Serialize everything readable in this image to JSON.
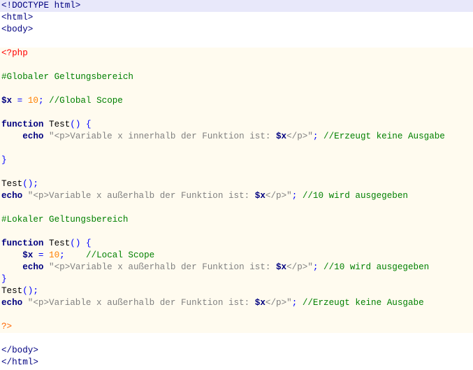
{
  "editor": {
    "lines": [
      {
        "bg": "highlight",
        "tokens": [
          {
            "t": "<!DOCTYPE html>",
            "c": "tag"
          }
        ]
      },
      {
        "bg": "",
        "tokens": [
          {
            "t": "<html>",
            "c": "tag"
          }
        ]
      },
      {
        "bg": "",
        "tokens": [
          {
            "t": "<body>",
            "c": "tag"
          }
        ]
      },
      {
        "bg": "",
        "tokens": []
      },
      {
        "bg": "php",
        "tokens": [
          {
            "t": "<?php",
            "c": "phptag"
          }
        ]
      },
      {
        "bg": "php",
        "tokens": []
      },
      {
        "bg": "php",
        "tokens": [
          {
            "t": "#Globaler Geltungsbereich",
            "c": "comment"
          }
        ]
      },
      {
        "bg": "php",
        "tokens": []
      },
      {
        "bg": "php",
        "tokens": [
          {
            "t": "$x",
            "c": "var"
          },
          {
            "t": " = ",
            "c": "op"
          },
          {
            "t": "10",
            "c": "num"
          },
          {
            "t": "; ",
            "c": "op"
          },
          {
            "t": "//Global Scope",
            "c": "comment"
          }
        ]
      },
      {
        "bg": "php",
        "tokens": []
      },
      {
        "bg": "php",
        "tokens": [
          {
            "t": "function",
            "c": "kw"
          },
          {
            "t": " Test",
            "c": "ident"
          },
          {
            "t": "() {",
            "c": "paren"
          }
        ]
      },
      {
        "bg": "php",
        "tokens": [
          {
            "t": "    echo",
            "c": "kw"
          },
          {
            "t": " \"<p>Variable x innerhalb der Funktion ist: ",
            "c": "str"
          },
          {
            "t": "$x",
            "c": "strvar"
          },
          {
            "t": "</p>\"",
            "c": "str"
          },
          {
            "t": "; ",
            "c": "op"
          },
          {
            "t": "//Erzeugt keine Ausgabe",
            "c": "comment"
          }
        ]
      },
      {
        "bg": "php",
        "tokens": []
      },
      {
        "bg": "php",
        "tokens": [
          {
            "t": "}",
            "c": "paren"
          }
        ]
      },
      {
        "bg": "php",
        "tokens": []
      },
      {
        "bg": "php",
        "tokens": [
          {
            "t": "Test",
            "c": "ident"
          },
          {
            "t": "();",
            "c": "paren"
          }
        ]
      },
      {
        "bg": "php",
        "tokens": [
          {
            "t": "echo",
            "c": "kw"
          },
          {
            "t": " \"<p>Variable x außerhalb der Funktion ist: ",
            "c": "str"
          },
          {
            "t": "$x",
            "c": "strvar"
          },
          {
            "t": "</p>\"",
            "c": "str"
          },
          {
            "t": "; ",
            "c": "op"
          },
          {
            "t": "//10 wird ausgegeben",
            "c": "comment"
          }
        ]
      },
      {
        "bg": "php",
        "tokens": []
      },
      {
        "bg": "php",
        "tokens": [
          {
            "t": "#Lokaler Geltungsbereich",
            "c": "comment"
          }
        ]
      },
      {
        "bg": "php",
        "tokens": []
      },
      {
        "bg": "php",
        "tokens": [
          {
            "t": "function",
            "c": "kw"
          },
          {
            "t": " Test",
            "c": "ident"
          },
          {
            "t": "() {",
            "c": "paren"
          }
        ]
      },
      {
        "bg": "php",
        "tokens": [
          {
            "t": "    $x",
            "c": "var"
          },
          {
            "t": " = ",
            "c": "op"
          },
          {
            "t": "10",
            "c": "num"
          },
          {
            "t": ";    ",
            "c": "op"
          },
          {
            "t": "//Local Scope",
            "c": "comment"
          }
        ]
      },
      {
        "bg": "php",
        "tokens": [
          {
            "t": "    echo",
            "c": "kw"
          },
          {
            "t": " \"<p>Variable x außerhalb der Funktion ist: ",
            "c": "str"
          },
          {
            "t": "$x",
            "c": "strvar"
          },
          {
            "t": "</p>\"",
            "c": "str"
          },
          {
            "t": "; ",
            "c": "op"
          },
          {
            "t": "//10 wird ausgegeben",
            "c": "comment"
          }
        ]
      },
      {
        "bg": "php",
        "tokens": [
          {
            "t": "}",
            "c": "paren"
          }
        ]
      },
      {
        "bg": "php",
        "tokens": [
          {
            "t": "Test",
            "c": "ident"
          },
          {
            "t": "();",
            "c": "paren"
          }
        ]
      },
      {
        "bg": "php",
        "tokens": [
          {
            "t": "echo",
            "c": "kw"
          },
          {
            "t": " \"<p>Variable x außerhalb der Funktion ist: ",
            "c": "str"
          },
          {
            "t": "$x",
            "c": "strvar"
          },
          {
            "t": "</p>\"",
            "c": "str"
          },
          {
            "t": "; ",
            "c": "op"
          },
          {
            "t": "//Erzeugt keine Ausgabe",
            "c": "comment"
          }
        ]
      },
      {
        "bg": "php",
        "tokens": []
      },
      {
        "bg": "php",
        "tokens": [
          {
            "t": "?>",
            "c": "phpend"
          }
        ]
      },
      {
        "bg": "",
        "tokens": []
      },
      {
        "bg": "",
        "tokens": [
          {
            "t": "</body>",
            "c": "tag"
          }
        ]
      },
      {
        "bg": "",
        "tokens": [
          {
            "t": "</html>",
            "c": "tag"
          }
        ]
      }
    ]
  },
  "colors": {
    "current_line_bg": "#e8e8fa",
    "php_block_bg": "#fffbef",
    "html_tag": "#000080",
    "php_open_tag": "#ff0000",
    "php_close_tag": "#ff6600",
    "comment": "#008000",
    "variable": "#000080",
    "operator": "#0000ff",
    "number": "#ff8000",
    "string": "#808080"
  }
}
